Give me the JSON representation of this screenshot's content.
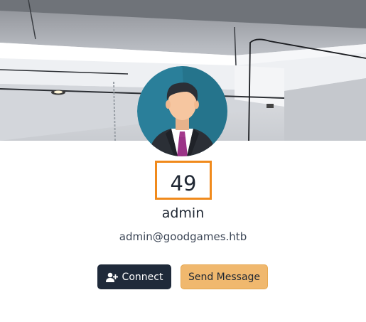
{
  "profile": {
    "count": "49",
    "username": "admin",
    "email": "admin@goodgames.htb"
  },
  "actions": {
    "connect_label": "Connect",
    "connect_icon": "user-plus-icon",
    "message_label": "Send Message"
  },
  "colors": {
    "count_border": "#f08a1c",
    "connect_bg": "#1f2a3a",
    "message_bg": "#f0b86e"
  }
}
